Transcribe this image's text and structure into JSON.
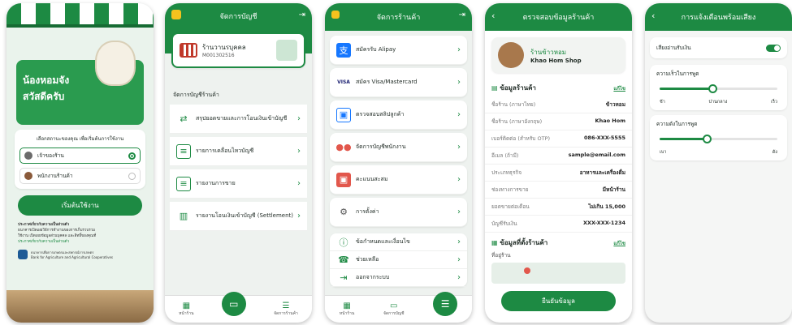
{
  "s1": {
    "greet1": "น้องหอมจัง",
    "greet2": "สวัสดีครับ",
    "choose": "เลือกสถานะของคุณ เพื่อเริ่มต้นการใช้งาน",
    "role1": "เจ้าของร้าน",
    "role2": "พนักงานร้านค้า",
    "start": "เริ่มต้นใช้งาน",
    "note_title": "ประกาศเกี่ยวกับความเป็นส่วนตัว",
    "note1": "ธนาคารเปิดเผยวิธีการทำงานของการเก็บรวบรวม",
    "note2": "ใช้งาน เปิดเผยข้อมูลส่วนบุคคล และสิทธิ์ของคุณที่",
    "note_link": "ประกาศเกี่ยวกับความเป็นส่วนตัว",
    "bank": "ธนาคารเพื่อการเกษตรและสหกรณ์การเกษตร",
    "bank_en": "Bank for Agriculture and Agricultural Cooperatives"
  },
  "s2": {
    "title": "จัดการบัญชี",
    "shop": "ร้านวานรบุคคล",
    "code": "M001302516",
    "section": "จัดการบัญชีร้านค้า",
    "items": [
      "สรุปยอดขายและการโอนเงินเข้าบัญชี",
      "รายการเคลื่อนไหวบัญชี",
      "รายงานการขาย",
      "รายงานโอนเงินเข้าบัญชี (Settlement)"
    ],
    "nav1": "หน้าร้าน",
    "nav2": "จัดการร้านค้า"
  },
  "s3": {
    "title": "จัดการร้านค้า",
    "items": [
      "สมัครรับ Alipay",
      "สมัคร Visa/Mastercard",
      "ตรวจสอบสลิปลูกค้า",
      "จัดการบัญชีพนักงาน",
      "คะแนนสะสม",
      "การตั้งค่า"
    ],
    "items2": [
      "ข้อกำหนดและเงื่อนไข",
      "ช่วยเหลือ",
      "ออกจากระบบ"
    ],
    "nav1": "หน้าร้าน",
    "nav2": "จัดการบัญชี"
  },
  "s4": {
    "title": "ตรวจสอบข้อมูลร้านค้า",
    "shop_th": "ร้านข้าวหอม",
    "shop_en": "Khao Hom Shop",
    "sec1": "ข้อมูลร้านค้า",
    "edit": "แก้ไข",
    "rows": [
      [
        "ชื่อร้าน (ภาษาไทย)",
        "ข้าวหอม"
      ],
      [
        "ชื่อร้าน (ภาษาอังกฤษ)",
        "Khao Hom"
      ],
      [
        "เบอร์ติดต่อ (สำหรับ OTP)",
        "086-XXX-5555"
      ],
      [
        "อีเมล (ถ้ามี)",
        "sample@email.com"
      ],
      [
        "ประเภทธุรกิจ",
        "อาหารและเครื่องดื่ม"
      ],
      [
        "ช่องทางการขาย",
        "มีหน้าร้าน"
      ],
      [
        "ยอดขายต่อเดือน",
        "ไม่เกิน 15,000"
      ],
      [
        "บัญชีรับเงิน",
        "XXX-XXX-1234"
      ]
    ],
    "sec2": "ข้อมูลที่ตั้งร้านค้า",
    "loc": "ที่อยู่ร้าน",
    "confirm": "ยืนยันข้อมูล"
  },
  "s5": {
    "title": "การแจ้งเตือนพร้อมเสียง",
    "sound": "เสียงอ่านรับเงิน",
    "speed": "ความเร็วในการพูด",
    "speed_labels": [
      "ช้า",
      "ปานกลาง",
      "เร็ว"
    ],
    "speed_val": 0.45,
    "volume": "ความดังในการพูด",
    "vol_labels": [
      "เบา",
      "ดัง"
    ],
    "vol_val": 0.4
  }
}
